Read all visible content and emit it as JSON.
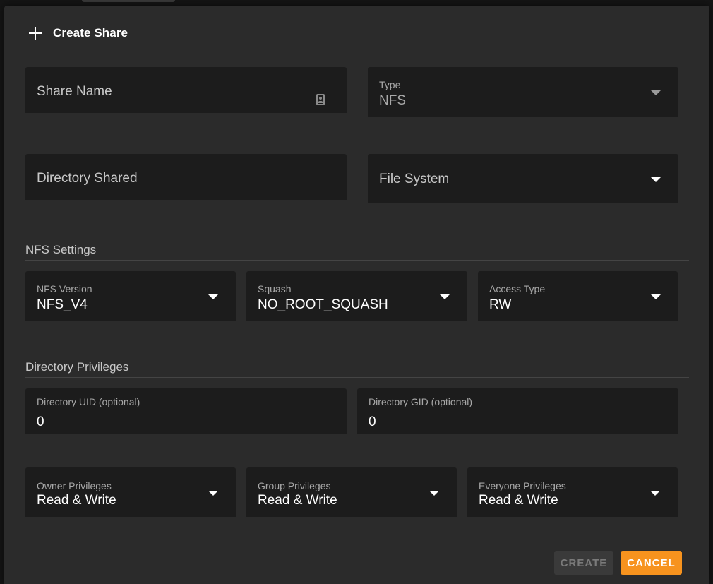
{
  "dialog": {
    "title": "Create Share",
    "title_icon": "plus-icon"
  },
  "fields": {
    "share_name": {
      "label": "Share Name",
      "icon": "contact-card-icon"
    },
    "type": {
      "label": "Type",
      "value": "NFS"
    },
    "directory_shared": {
      "label": "Directory Shared"
    },
    "file_system": {
      "label": "File System"
    }
  },
  "nfs_settings": {
    "title": "NFS Settings",
    "nfs_version": {
      "label": "NFS Version",
      "value": "NFS_V4"
    },
    "squash": {
      "label": "Squash",
      "value": "NO_ROOT_SQUASH"
    },
    "access_type": {
      "label": "Access Type",
      "value": "RW"
    }
  },
  "directory_privileges": {
    "title": "Directory Privileges",
    "uid": {
      "label": "Directory UID (optional)",
      "value": "0"
    },
    "gid": {
      "label": "Directory GID (optional)",
      "value": "0"
    },
    "owner": {
      "label": "Owner Privileges",
      "value": "Read & Write"
    },
    "group": {
      "label": "Group Privileges",
      "value": "Read & Write"
    },
    "everyone": {
      "label": "Everyone Privileges",
      "value": "Read & Write"
    }
  },
  "actions": {
    "create_label": "CREATE",
    "cancel_label": "CANCEL"
  },
  "colors": {
    "accent": "#f7931e",
    "dialog_bg": "#2b2b2b",
    "field_bg": "#1c1c1c"
  }
}
